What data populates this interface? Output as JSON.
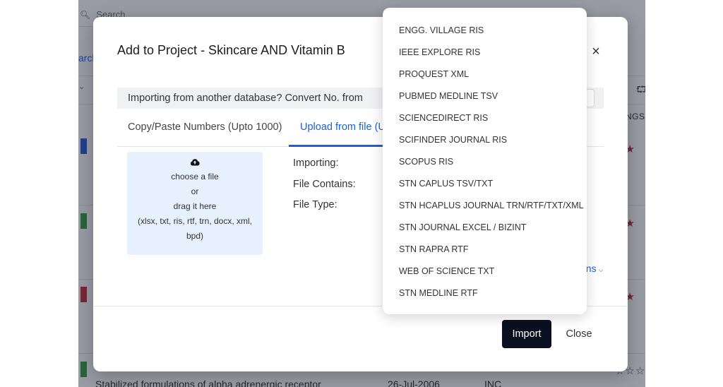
{
  "background": {
    "search_placeholder": "Search",
    "search_link_fragment": "arch",
    "column_header_fragment": "NGS",
    "row_indicator_colors": [
      "#1f4fc4",
      "#2f8f3a",
      "#b3262f",
      "#2f8f3a"
    ],
    "bottom_row_title": "Stabilized formulations of alpha adrenergic receptor",
    "bottom_row_date": "26-Jul-2006",
    "bottom_row_assignee": "INC",
    "filled_stars": "★★",
    "empty_stars": "☆☆☆"
  },
  "modal": {
    "title": "Add to Project - Skincare AND Vitamin B",
    "close_icon": "×",
    "convert_bar_label": "Importing from another database? Convert No. from",
    "tabs": [
      {
        "label": "Copy/Paste Numbers (Upto 1000)",
        "active": false
      },
      {
        "label": "Upload from file (U",
        "active": true
      }
    ],
    "dropzone": {
      "icon": "cloud-upload-icon",
      "line1": "choose a file",
      "line2": "or",
      "line3": "drag it here",
      "line4": "(xlsx, txt, ris, rtf, trn, docx, xml,",
      "line5": "bpd)"
    },
    "info": {
      "importing_label": "Importing:",
      "file_contains_label": "File Contains:",
      "file_type_label": "File Type:"
    },
    "more_options_fragment": "ons",
    "import_label": "Import",
    "close_label": "Close"
  },
  "dropdown": {
    "options": [
      "ENGG. VILLAGE RIS",
      "IEEE EXPLORE RIS",
      "PROQUEST XML",
      "PUBMED MEDLINE TSV",
      "SCIENCEDIRECT RIS",
      "SCIFINDER JOURNAL RIS",
      "SCOPUS RIS",
      "STN CAPLUS TSV/TXT",
      "STN HCAPLUS JOURNAL TRN/RTF/TXT/XML",
      "STN JOURNAL EXCEL / BIZINT",
      "STN RAPRA RTF",
      "WEB OF SCIENCE TXT",
      "STN MEDLINE RTF"
    ]
  }
}
